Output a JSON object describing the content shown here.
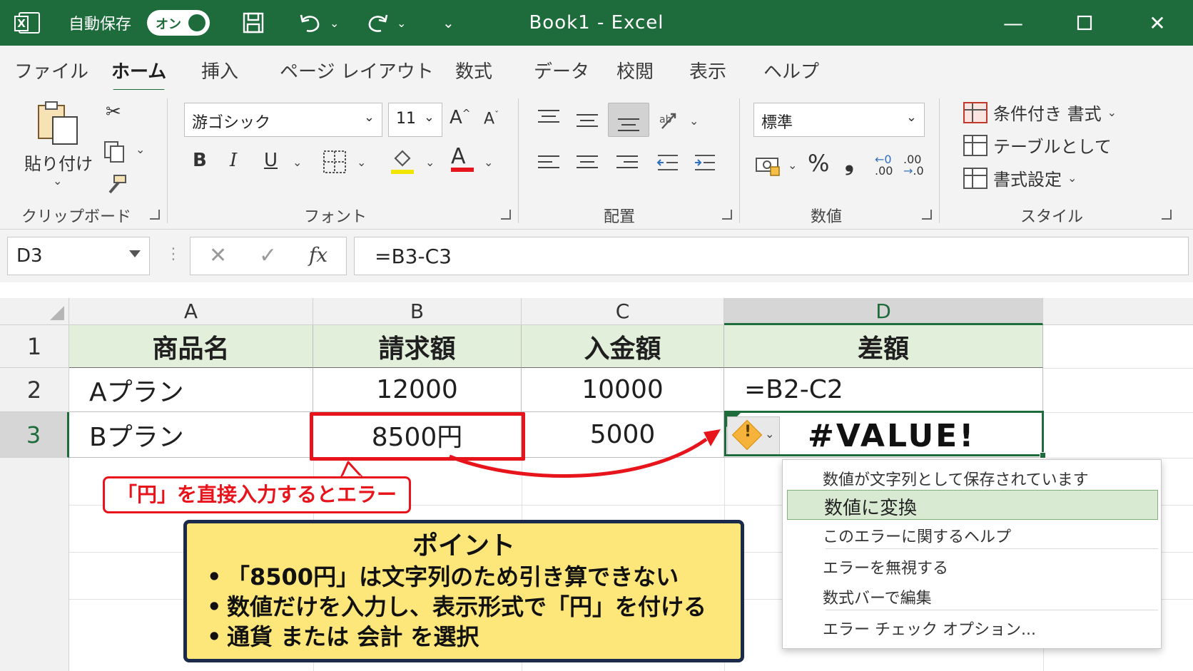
{
  "window": {
    "autosave_label": "自動保存",
    "autosave_state": "オン",
    "title": "Book1  -  Excel"
  },
  "ribbon_tabs": [
    "ファイル",
    "ホーム",
    "挿入",
    "ページ レイアウト",
    "数式",
    "データ",
    "校閲",
    "表示",
    "ヘルプ"
  ],
  "ribbon": {
    "clipboard": {
      "paste_label": "貼り付け",
      "group_label": "クリップボード"
    },
    "font": {
      "font_name": "游ゴシック",
      "font_size": "11",
      "bold": "B",
      "italic": "I",
      "underline": "U",
      "font_color_glyph": "A",
      "group_label": "フォント",
      "highlight_color": "#f2e500",
      "font_color": "#e8141c"
    },
    "alignment": {
      "group_label": "配置"
    },
    "number": {
      "format": "標準",
      "percent": "%",
      "comma": "❟",
      "inc_decimal": ".00",
      "dec_decimal": ".0",
      "group_label": "数値"
    },
    "styles": {
      "conditional": "条件付き 書式",
      "table": "テーブルとして",
      "cell_styles": "書式設定",
      "group_label": "スタイル"
    }
  },
  "formula_bar": {
    "name_box": "D3",
    "fx": "fx",
    "formula": "=B3-C3"
  },
  "sheet": {
    "columns": [
      "A",
      "B",
      "C",
      "D"
    ],
    "rows": [
      "1",
      "2",
      "3"
    ],
    "header_row": [
      "商品名",
      "請求額",
      "入金額",
      "差額"
    ],
    "row2": [
      "Aプラン",
      "12000",
      "10000",
      "=B2-C2"
    ],
    "row3": [
      "Bプラン",
      "8500円",
      "5000",
      "#VALUE!"
    ]
  },
  "annotations": {
    "callout": "「円」を直接入力するとエラー",
    "point_title": "ポイント",
    "points": [
      "「8500円」は文字列のため引き算できない",
      "数値だけを入力し、表示形式で「円」を付ける",
      "通貨 または 会計 を選択"
    ],
    "accent_red": "#e8141c",
    "point_bg": "#fde77a"
  },
  "error_menu": {
    "header": "数値が文字列として保存されています",
    "items": [
      "数値に変換",
      "このエラーに関するヘルプ",
      "エラーを無視する",
      "数式バーで編集",
      "エラー チェック オプション..."
    ]
  },
  "colors": {
    "excel_green": "#1e6b3c",
    "header_fill": "#e2efda"
  }
}
